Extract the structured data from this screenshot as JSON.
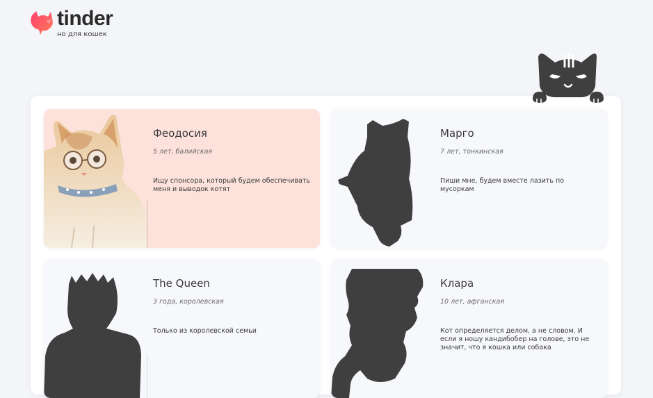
{
  "header": {
    "logo_title": "tinder",
    "logo_subtitle": "но для кошек",
    "logo_icon": "flame-cat-icon",
    "accent_gradient": [
      "#ff3f6e",
      "#ff7a5a"
    ]
  },
  "mascot": {
    "icon": "peeking-cat-icon",
    "color": "#3f3f3f"
  },
  "cards": [
    {
      "name": "Феодосия",
      "meta": "5 лет, балийская",
      "description": "Ищу спонсора, который будем обеспечивать меня и выводок котят",
      "photo": "cat-with-glasses-photo",
      "active": true
    },
    {
      "name": "Марго",
      "meta": "7 лет, тонкинская",
      "description": "Пиши мне, будем вместе лазить по мусоркам",
      "photo": "cat-silhouette-icon",
      "active": false
    },
    {
      "name": "The Queen",
      "meta": "3 года, королевская",
      "description": "Только из королевской семьи",
      "photo": "crowned-cat-silhouette-icon",
      "active": false
    },
    {
      "name": "Клара",
      "meta": "10 лет, афганская",
      "description": "Кот определяется делом, а не словом. И если я ношу кандибобер на голове, это не значит, что я кошка или собака",
      "photo": "hat-cat-silhouette-icon",
      "active": false
    }
  ],
  "colors": {
    "background": "#f4f5f8",
    "active_card": "#fde2dc",
    "card": "#f7f8fb",
    "silhouette": "#3f3f3f"
  }
}
